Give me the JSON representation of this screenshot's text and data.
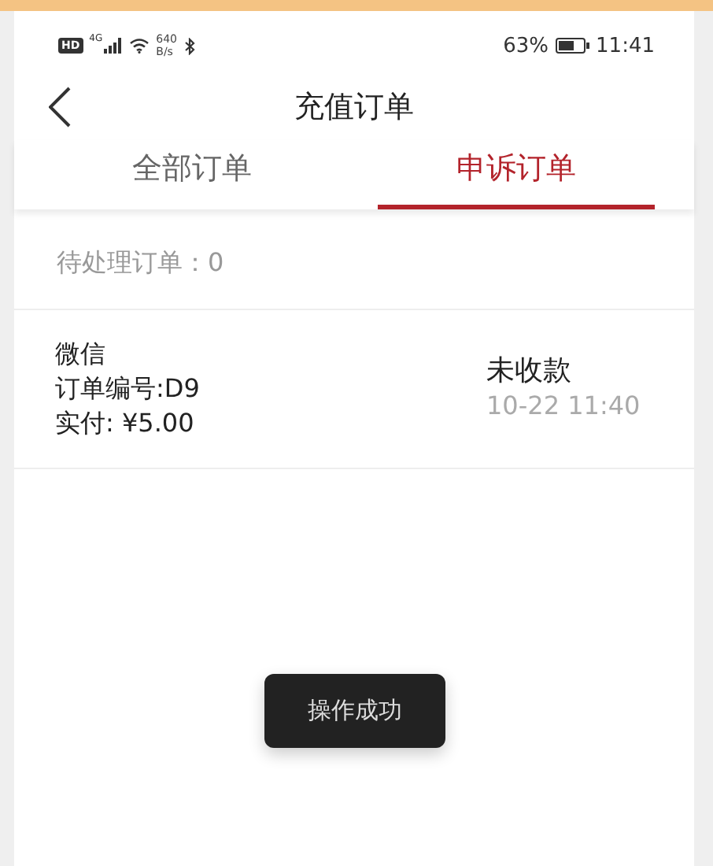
{
  "status_bar": {
    "hd": "HD",
    "net": "4G",
    "speed_value": "640",
    "speed_unit": "B/s",
    "battery_percent": "63%",
    "time": "11:41"
  },
  "header": {
    "title": "充值订单"
  },
  "tabs": [
    {
      "label": "全部订单",
      "selected": false
    },
    {
      "label": "申诉订单",
      "selected": true
    }
  ],
  "pending": "待处理订单：0",
  "orders": [
    {
      "method": "微信",
      "order_no": "订单编号:D9",
      "paid": "实付: ¥5.00",
      "status": "未收款",
      "time": "10-22 11:40"
    }
  ],
  "toast": "操作成功"
}
